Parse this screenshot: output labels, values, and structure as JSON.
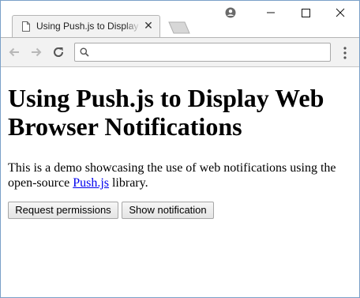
{
  "tab": {
    "title": "Using Push.js to Display Web Browser Notifications",
    "close_glyph": "✕",
    "favicon": "page-icon"
  },
  "window_controls": [
    "minimize-icon",
    "maximize-icon",
    "close-icon"
  ],
  "toolbar": {
    "icons": [
      "back-arrow-icon",
      "forward-arrow-icon",
      "reload-icon",
      "search-icon",
      "kebab-menu-icon"
    ],
    "address_value": "",
    "address_placeholder": ""
  },
  "page": {
    "heading": "Using Push.js to Display Web Browser Notifications",
    "intro_before": "This is a demo showcasing the use of web notifications using the open-source ",
    "intro_link": "Push.js",
    "intro_after": " library.",
    "buttons": {
      "request": "Request permissions",
      "show": "Show notification"
    }
  },
  "colors": {
    "window_border": "#7aa0c8",
    "toolbar_bg": "#f2f2f2",
    "link": "#0000ee"
  }
}
